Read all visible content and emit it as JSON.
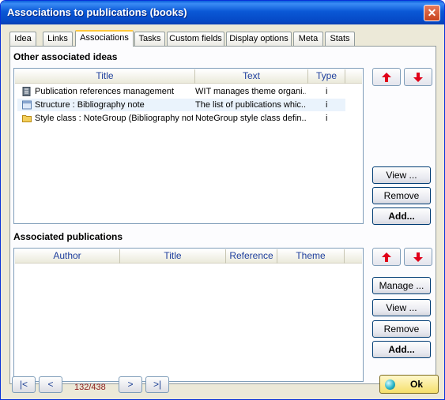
{
  "window": {
    "title": "Associations to publications (books)",
    "close_glyph": "✕"
  },
  "tabs": [
    {
      "label": "Idea"
    },
    {
      "label": "Links"
    },
    {
      "label": "Associations"
    },
    {
      "label": "Tasks"
    },
    {
      "label": "Custom fields"
    },
    {
      "label": "Display options"
    },
    {
      "label": "Meta"
    },
    {
      "label": "Stats"
    }
  ],
  "active_tab": "Associations",
  "ideas": {
    "section_label": "Other associated ideas",
    "columns": [
      "Title",
      "Text",
      "Type"
    ],
    "rows": [
      {
        "icon": "document-icon",
        "title": "Publication references management",
        "text": "WIT manages theme organi...",
        "type": "i"
      },
      {
        "icon": "note-icon",
        "title": "Structure : Bibliography note",
        "text": "The list of publications whic...",
        "type": "i",
        "selected": true
      },
      {
        "icon": "folder-icon",
        "title": "Style class : NoteGroup (Bibliography not...",
        "text": "NoteGroup style class defin...",
        "type": "i"
      }
    ],
    "buttons": {
      "view": "View ...",
      "remove": "Remove",
      "add": "Add..."
    }
  },
  "publications": {
    "section_label": "Associated publications",
    "columns": [
      "Author",
      "Title",
      "Reference",
      "Theme"
    ],
    "rows": [],
    "buttons": {
      "manage": "Manage ...",
      "view": "View ...",
      "remove": "Remove",
      "add": "Add..."
    }
  },
  "navigation": {
    "first": "|<",
    "prev": "<",
    "counter": "132/438",
    "next": ">",
    "last": ">|"
  },
  "ok_label": "Ok",
  "colors": {
    "move_arrow": "#e0001a",
    "counter": "#8b1a1a",
    "title_bar": "#0a58d6"
  }
}
